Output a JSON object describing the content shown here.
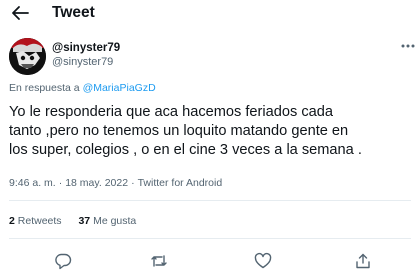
{
  "header": {
    "title": "Tweet",
    "back_icon": "arrow-left-icon"
  },
  "tweet": {
    "handle_primary": "@sinyster79",
    "handle_secondary": "@sinyster79",
    "reply_prefix": "En respuesta a",
    "reply_mention": "@MariaPiaGzD",
    "text_lines": [
      "Yo le responderia que aca  hacemos feriados cada",
      "tanto ,pero no tenemos un loquito matando gente en",
      "los super, colegios , o en el cine 3 veces a la semana ."
    ],
    "time": "9:46 a. m.",
    "date": "18 may. 2022",
    "source": "Twitter for Android",
    "retweets": {
      "count": "2",
      "label": "Retweets"
    },
    "likes": {
      "count": "37",
      "label": "Me gusta"
    }
  },
  "actions": [
    "reply-icon",
    "retweet-icon",
    "like-icon",
    "share-icon"
  ],
  "colors": {
    "accent": "#1d9bf0",
    "text": "#0f1419",
    "secondary": "#536471",
    "divider": "#e6ecf0"
  }
}
